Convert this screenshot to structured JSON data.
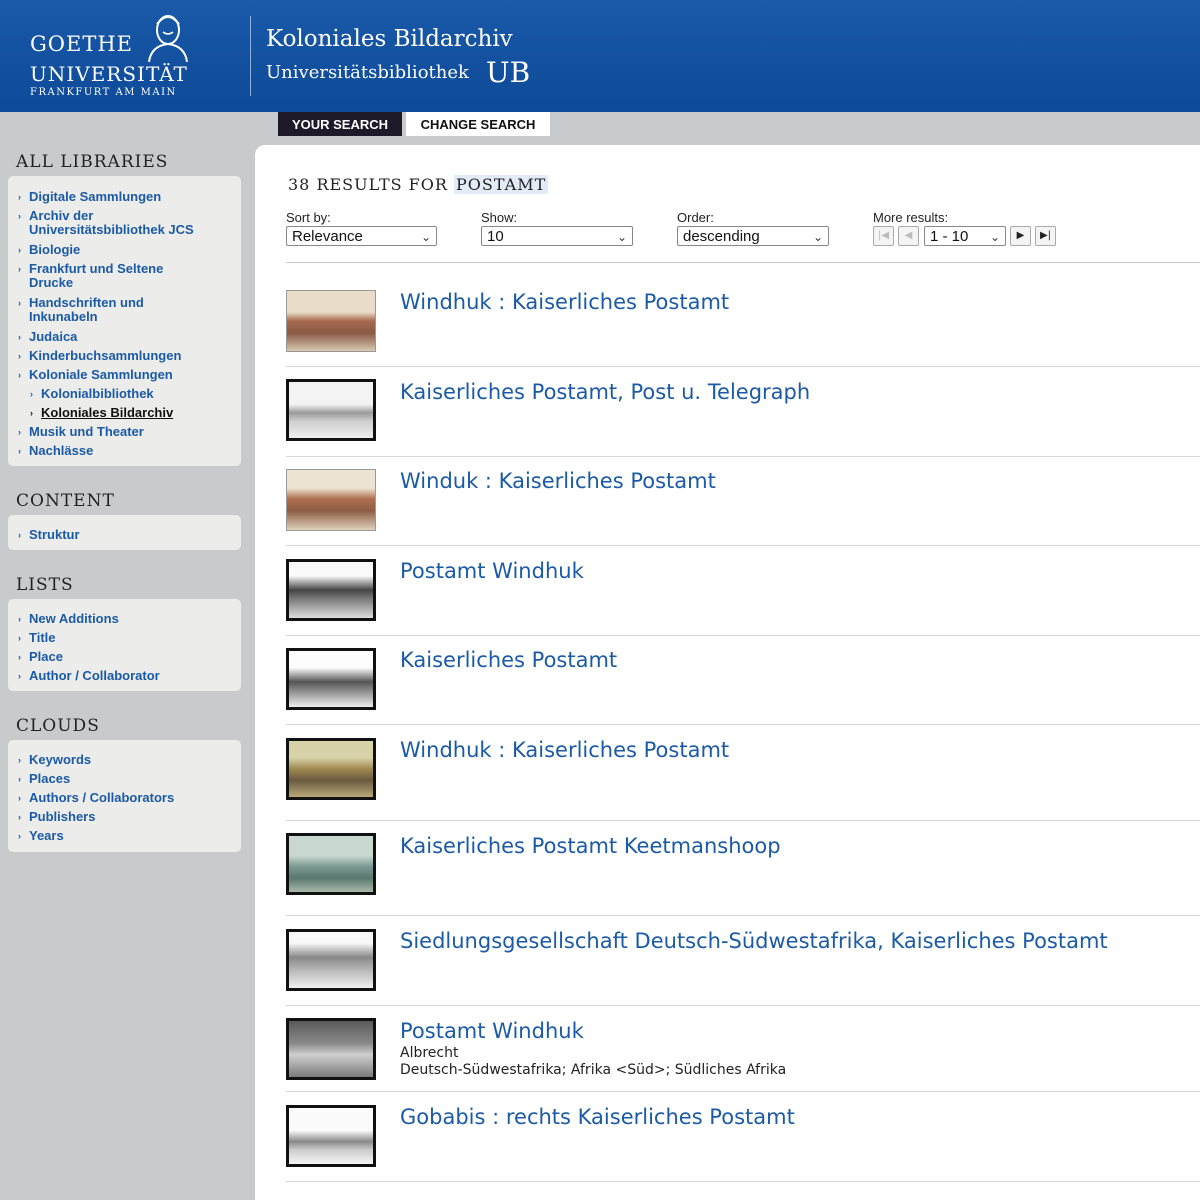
{
  "header": {
    "logo_line1": "GOETHE",
    "logo_line2": "UNIVERSITÄT",
    "logo_line3": "FRANKFURT AM MAIN",
    "title": "Koloniales Bildarchiv",
    "subtitle": "Universitätsbibliothek",
    "ub": "UB"
  },
  "tabs": {
    "your_search": "YOUR SEARCH",
    "change_search": "CHANGE SEARCH"
  },
  "sidebar": {
    "all_libraries": {
      "heading": "ALL LIBRARIES",
      "items": [
        "Digitale Sammlungen",
        "Archiv der",
        "Universitätsbibliothek JCS",
        "Biologie",
        "Frankfurt und Seltene",
        "Drucke",
        "Handschriften und",
        "Inkunabeln",
        "Judaica",
        "Kinderbuchsammlungen",
        "Koloniale Sammlungen",
        "Kolonialbibliothek",
        "Koloniales Bildarchiv",
        "Musik und Theater",
        "Nachlässe"
      ]
    },
    "content": {
      "heading": "CONTENT",
      "items": [
        "Struktur"
      ]
    },
    "lists": {
      "heading": "LISTS",
      "items": [
        "New Additions",
        "Title",
        "Place",
        "Author / Collaborator"
      ]
    },
    "clouds": {
      "heading": "CLOUDS",
      "items": [
        "Keywords",
        "Places",
        "Authors / Collaborators",
        "Publishers",
        "Years"
      ]
    }
  },
  "results": {
    "count_text": "38 RESULTS FOR",
    "query": "POSTAMT",
    "sort_label": "Sort by:",
    "sort_value": "Relevance",
    "show_label": "Show:",
    "show_value": "10",
    "order_label": "Order:",
    "order_value": "descending",
    "more_label": "More results:",
    "page_value": "1 - 10",
    "items": [
      {
        "title": "Windhuk : Kaiserliches Postamt"
      },
      {
        "title": "Kaiserliches Postamt, Post u. Telegraph"
      },
      {
        "title": "Winduk : Kaiserliches Postamt"
      },
      {
        "title": "Postamt Windhuk"
      },
      {
        "title": "Kaiserliches Postamt"
      },
      {
        "title": "Windhuk : Kaiserliches Postamt"
      },
      {
        "title": "Kaiserliches Postamt Keetmanshoop"
      },
      {
        "title": "Siedlungsgesellschaft Deutsch-Südwestafrika, Kaiserliches Postamt"
      },
      {
        "title": "Postamt Windhuk",
        "author": "Albrecht",
        "place": "Deutsch-Südwestafrika; Afrika <Süd>; Südliches Afrika"
      },
      {
        "title": "Gobabis : rechts Kaiserliches Postamt"
      }
    ]
  },
  "colors": {
    "header_blue": "#0d4a99",
    "link_blue": "#1b5aa6",
    "sidebar_bg": "#c9cacb"
  }
}
